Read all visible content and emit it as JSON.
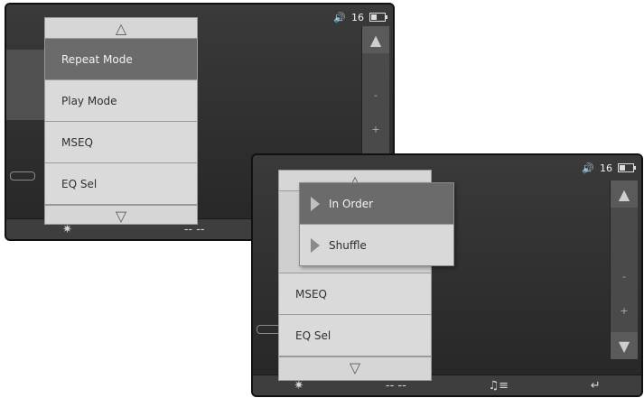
{
  "status": {
    "volume_icon": "speaker-icon",
    "volume_value": "16",
    "battery_icon": "battery-icon"
  },
  "screen1": {
    "menu": {
      "up_arrow": "△",
      "items": [
        {
          "label": "Repeat Mode",
          "selected": true
        },
        {
          "label": "Play Mode",
          "selected": false
        },
        {
          "label": "MSEQ",
          "selected": false
        },
        {
          "label": "EQ Sel",
          "selected": false
        }
      ],
      "down_arrow": "▽"
    }
  },
  "screen2": {
    "menu": {
      "up_arrow": "△",
      "items": [
        {
          "label": "MSEQ"
        },
        {
          "label": "EQ Sel"
        }
      ],
      "down_arrow": "▽"
    },
    "submenu": {
      "items": [
        {
          "label": "In Order",
          "selected": true
        },
        {
          "label": "Shuffle",
          "selected": false
        }
      ]
    },
    "side_controls": {
      "minus": "-",
      "plus": "+"
    },
    "bottom_bar": [
      {
        "icon": "gear-icon",
        "glyph": "✷"
      },
      {
        "icon": "dash-icon",
        "glyph": "-- --"
      },
      {
        "icon": "playlist-icon",
        "glyph": "♫≡"
      },
      {
        "icon": "back-icon",
        "glyph": "↵"
      }
    ]
  },
  "colors": {
    "selected_bg": "#6b6b6b",
    "menu_bg": "#d6d6d6",
    "screen_bg": "#2f2f2f"
  }
}
